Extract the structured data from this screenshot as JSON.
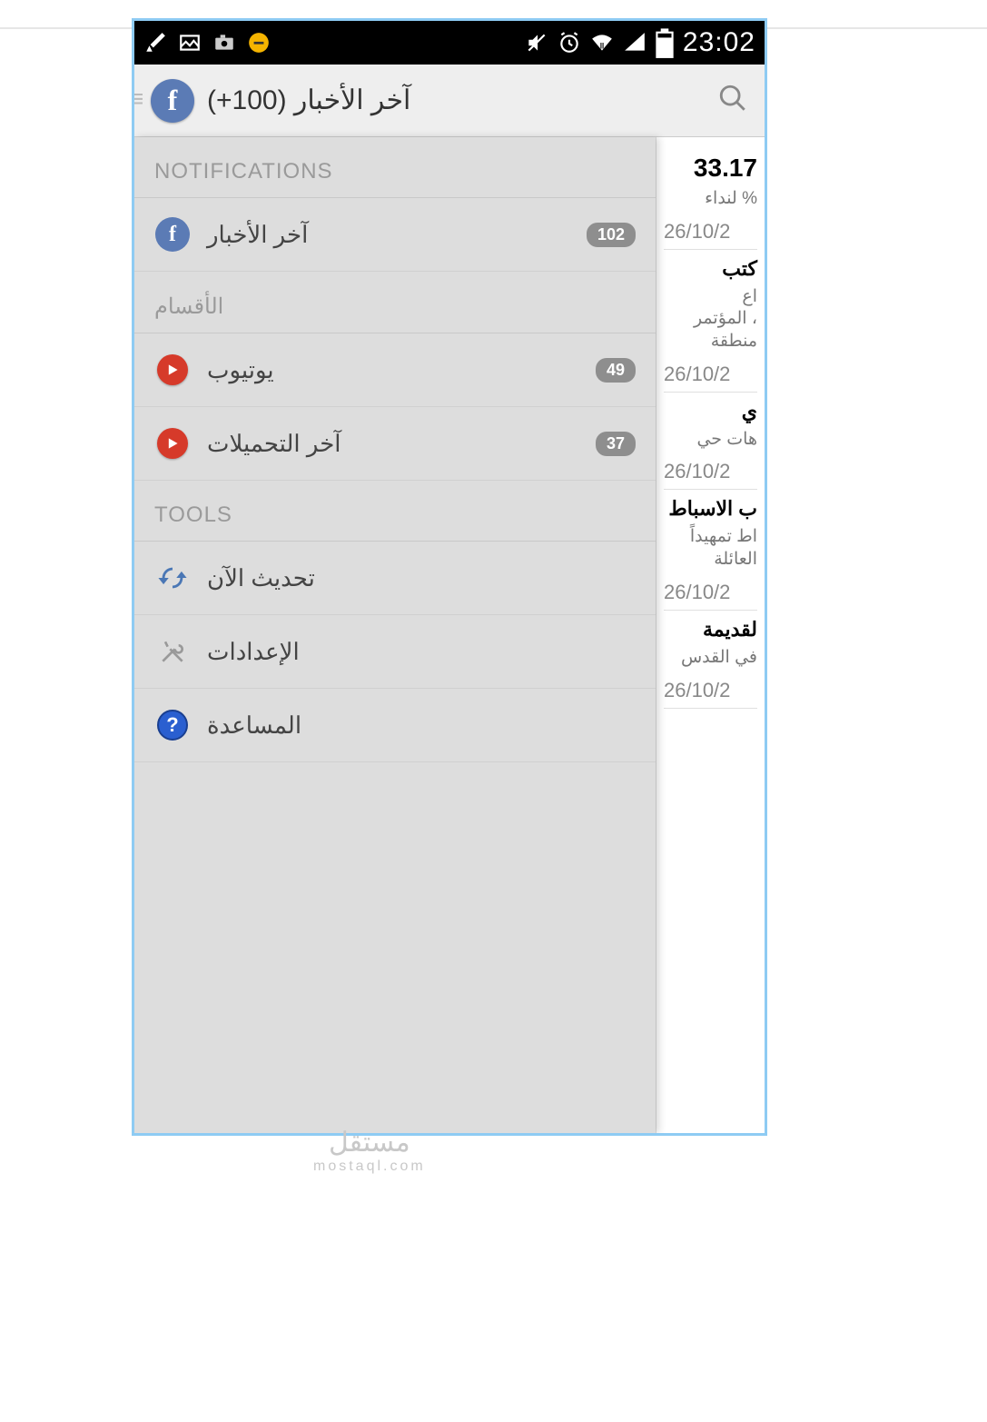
{
  "statusbar": {
    "time": "23:02"
  },
  "header": {
    "title": "آخر الأخبار (100+)"
  },
  "drawer": {
    "section_notifications": "NOTIFICATIONS",
    "section_categories": "الأقسام",
    "section_tools": "TOOLS",
    "items": {
      "news": {
        "label": "آخر الأخبار",
        "badge": "102"
      },
      "youtube": {
        "label": "يوتيوب",
        "badge": "49"
      },
      "downloads": {
        "label": "آخر التحميلات",
        "badge": "37"
      },
      "refresh": {
        "label": "تحديث الآن"
      },
      "settings": {
        "label": "الإعدادات"
      },
      "help": {
        "label": "المساعدة"
      }
    }
  },
  "background": {
    "top_number": "33.17",
    "item0_sub": "% لنداء",
    "date": "26/10/2",
    "item1_title": "كتب",
    "item1_sub": "اع\n، المؤتمر\nمنطقة",
    "item2_title": "ي",
    "item2_sub": "هات حي",
    "item3_title": "ب الاسباط",
    "item3_sub": "اط تمهيداً\nالعائلة",
    "item4_title": "لقديمة",
    "item4_sub": "في القدس"
  },
  "watermark": {
    "main": "مستقل",
    "sub": "mostaql.com"
  }
}
